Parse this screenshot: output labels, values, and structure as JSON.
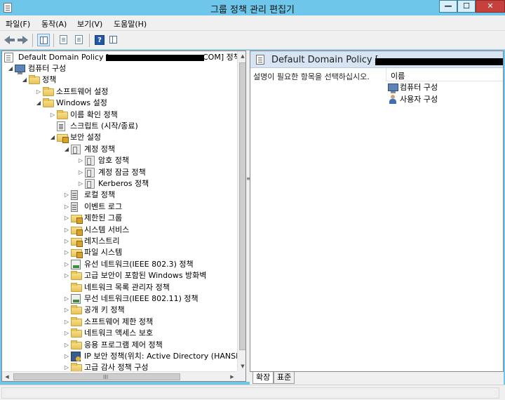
{
  "window": {
    "title": "그룹 정책 관리 편집기",
    "controls": {
      "minimize": "—",
      "maximize": "☐",
      "close": "✕"
    }
  },
  "menu": [
    "파일(F)",
    "동작(A)",
    "보기(V)",
    "도움말(H)"
  ],
  "toolbar": {
    "buttons": [
      "back-icon",
      "forward-icon",
      "show-hide-tree-icon",
      "properties-icon",
      "export-list-icon",
      "help-icon",
      "show-pane-icon"
    ]
  },
  "tree": {
    "root_label": "Default Domain Policy [",
    "root_suffix": "COM] 정책",
    "items": [
      {
        "label": "컴퓨터 구성",
        "expander": "◢",
        "icon": "computer-icon"
      },
      {
        "label": "정책",
        "expander": "◢",
        "icon": "folder-icon"
      },
      {
        "label": "소프트웨어 설정",
        "expander": "▷",
        "icon": "folder-icon"
      },
      {
        "label": "Windows 설정",
        "expander": "◢",
        "icon": "folder-icon"
      },
      {
        "label": "이름 확인 정책",
        "expander": "▷",
        "icon": "folder-icon"
      },
      {
        "label": "스크립트 (시작/종료)",
        "expander": "",
        "icon": "script-icon"
      },
      {
        "label": "보안 설정",
        "expander": "◢",
        "icon": "security-settings-icon"
      },
      {
        "label": "계정 정책",
        "expander": "◢",
        "icon": "account-policy-icon"
      },
      {
        "label": "암호 정책",
        "expander": "▷",
        "icon": "account-policy-icon"
      },
      {
        "label": "계정 잠금 정책",
        "expander": "▷",
        "icon": "account-policy-icon"
      },
      {
        "label": "Kerberos 정책",
        "expander": "▷",
        "icon": "account-policy-icon"
      },
      {
        "label": "로컬 정책",
        "expander": "▷",
        "icon": "server-icon"
      },
      {
        "label": "이벤트 로그",
        "expander": "▷",
        "icon": "server-icon"
      },
      {
        "label": "제한된 그룹",
        "expander": "▷",
        "icon": "secure-folder-icon"
      },
      {
        "label": "시스템 서비스",
        "expander": "▷",
        "icon": "secure-folder-icon"
      },
      {
        "label": "레지스트리",
        "expander": "▷",
        "icon": "secure-folder-icon"
      },
      {
        "label": "파일 시스템",
        "expander": "▷",
        "icon": "secure-folder-icon"
      },
      {
        "label": "유선 네트워크(IEEE 802.3) 정책",
        "expander": "▷",
        "icon": "wired-network-icon"
      },
      {
        "label": "고급 보안이 포함된 Windows 방화벽",
        "expander": "▷",
        "icon": "firewall-icon"
      },
      {
        "label": "네트워크 목록 관리자 정책",
        "expander": "",
        "icon": "folder-icon"
      },
      {
        "label": "무선 네트워크(IEEE 802.11) 정책",
        "expander": "▷",
        "icon": "wireless-network-icon"
      },
      {
        "label": "공개 키 정책",
        "expander": "▷",
        "icon": "folder-icon"
      },
      {
        "label": "소프트웨어 제한 정책",
        "expander": "▷",
        "icon": "folder-icon"
      },
      {
        "label": "네트워크 액세스 보호",
        "expander": "▷",
        "icon": "folder-icon"
      },
      {
        "label": "응용 프로그램 제어 정책",
        "expander": "▷",
        "icon": "folder-icon"
      },
      {
        "label": "IP 보안 정책(위치: Active Directory (HANSHIN",
        "expander": "▷",
        "icon": "ipsec-icon"
      },
      {
        "label": "고급 감사 정책 구성",
        "expander": "▷",
        "icon": "folder-icon"
      }
    ]
  },
  "scrollbar": {
    "up": "▲",
    "down": "▼",
    "left": "◀",
    "right": "▶",
    "grip": "III"
  },
  "splitter_grip": "≡",
  "right_pane": {
    "title": "Default Domain Policy [",
    "description": "설명이 필요한 항목을 선택하십시오.",
    "column_header": "이름",
    "items": [
      {
        "label": "컴퓨터 구성",
        "icon": "computer-icon"
      },
      {
        "label": "사용자 구성",
        "icon": "user-icon"
      }
    ]
  },
  "tabs": [
    "확장",
    "표준"
  ]
}
